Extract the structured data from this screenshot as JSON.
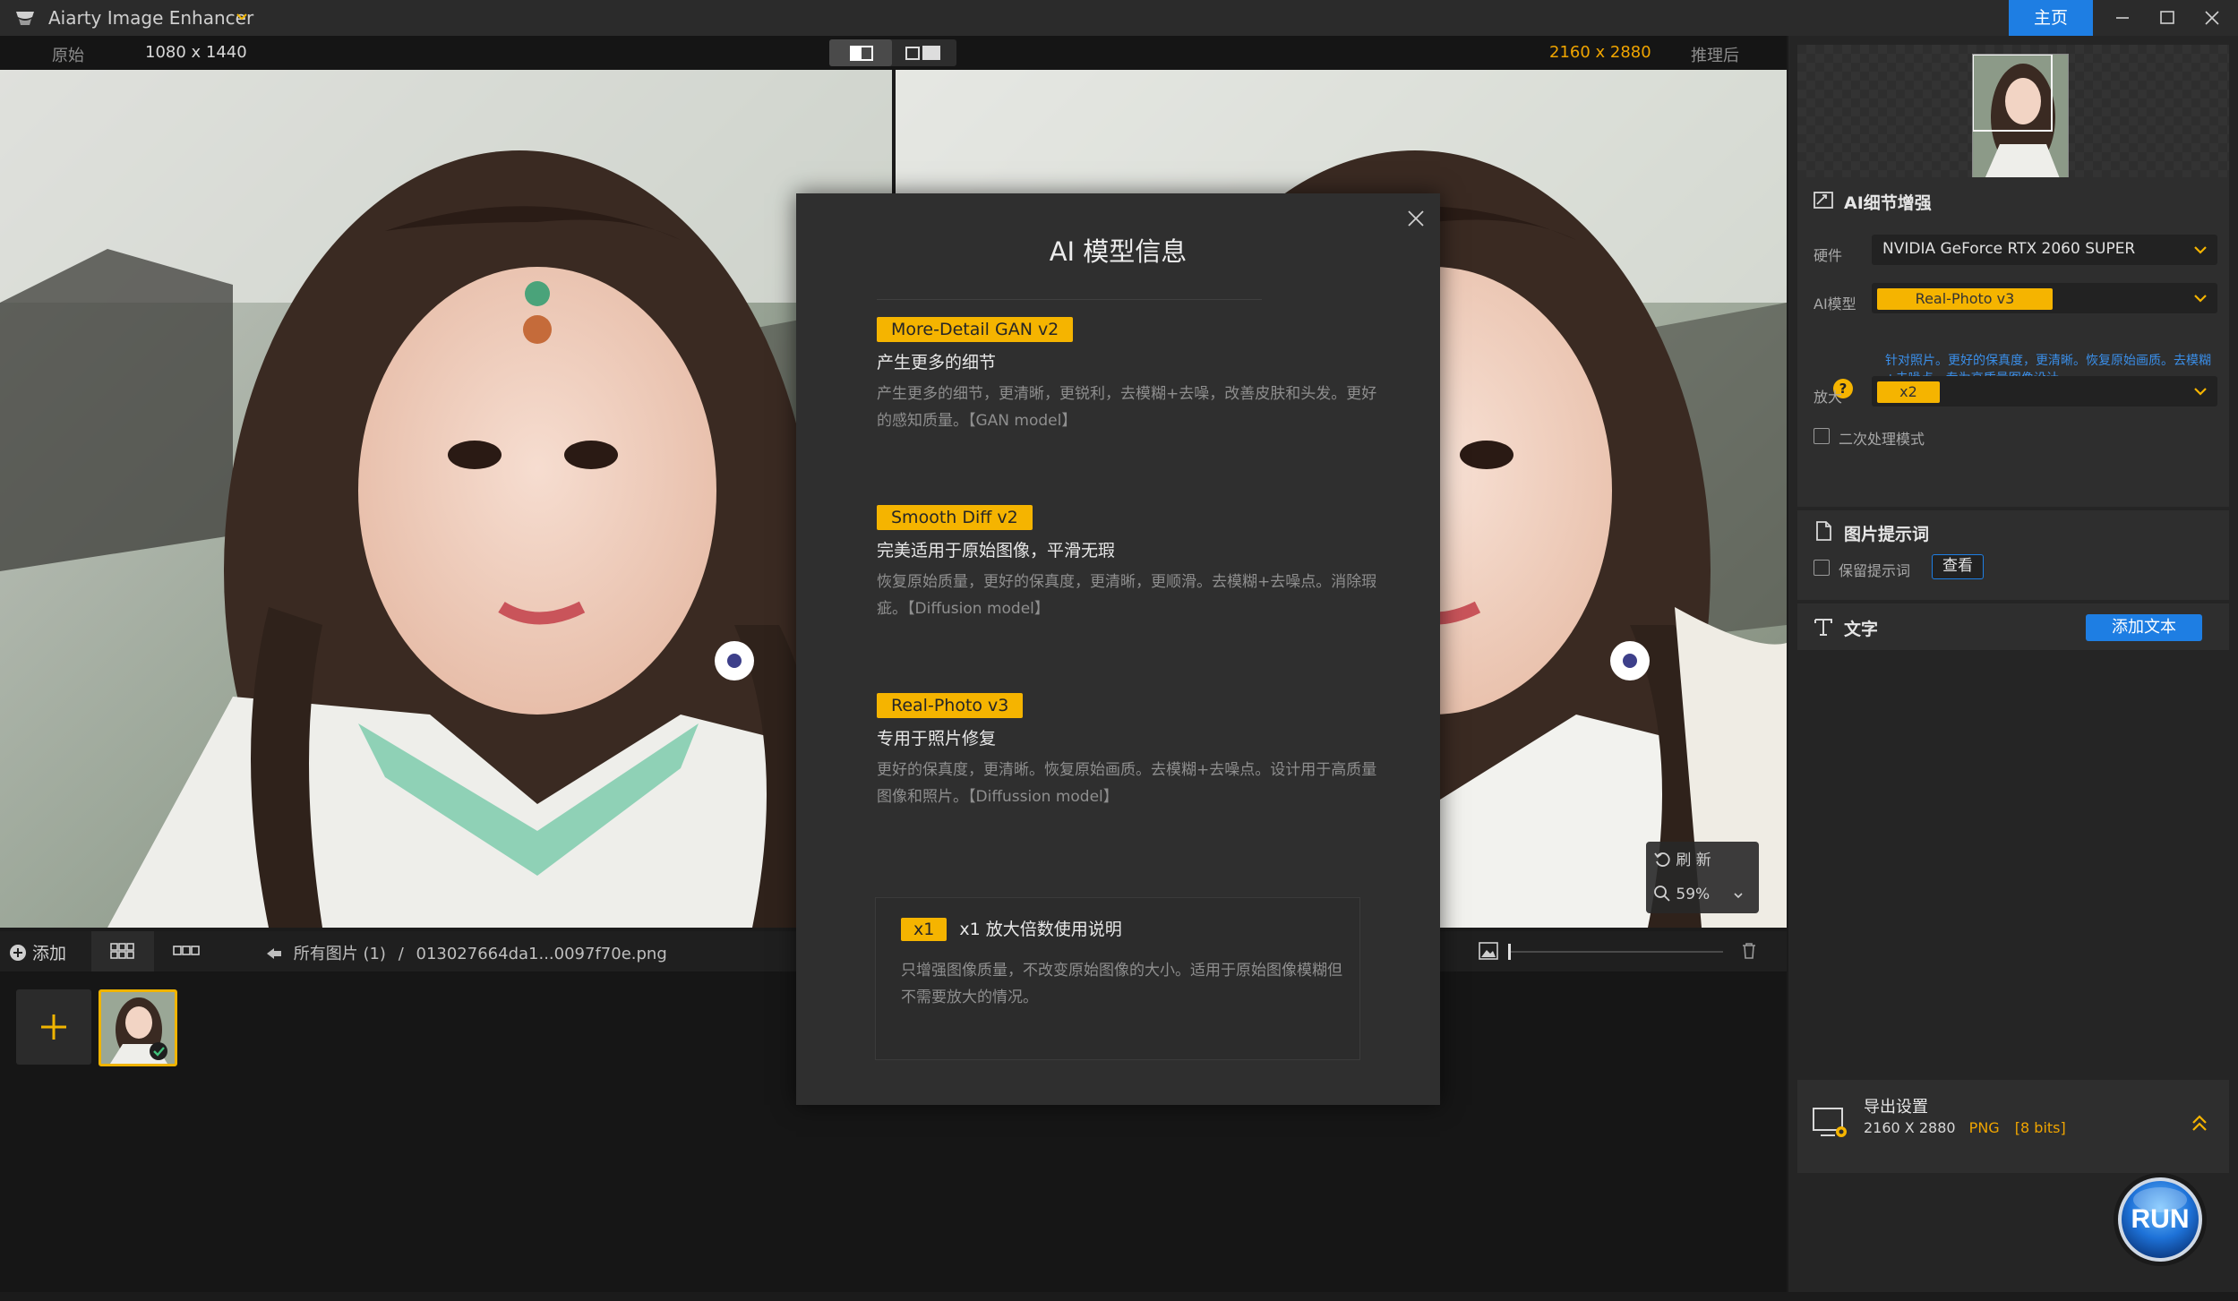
{
  "titlebar": {
    "app_title": "Aiarty Image Enhancer",
    "home_label": "主页"
  },
  "compare": {
    "original_label": "原始",
    "original_size": "1080 x 1440",
    "output_size": "2160 x 2880",
    "after_label": "推理后"
  },
  "zoom_widget": {
    "refresh_label": "刷 新",
    "zoom_value": "59%"
  },
  "filmstrip": {
    "add_label": "添加",
    "breadcrumb_root": "所有图片 (1)",
    "breadcrumb_sep": "/",
    "file_name": "013027664da1...0097f70e.png"
  },
  "right_panel": {
    "ai_section_title": "AI细节增强",
    "hardware_label": "硬件",
    "hardware_value": "NVIDIA GeForce RTX 2060 SUPER",
    "model_label": "AI模型",
    "model_value": "Real-Photo v3",
    "model_description": "针对照片。更好的保真度，更清晰。恢复原始画质。去模糊+去噪点。专为高质量图像设计。",
    "scale_label": "放大",
    "scale_value": "x2",
    "secondary_mode_label": "二次处理模式",
    "prompt_section_title": "图片提示词",
    "keep_prompt_label": "保留提示词",
    "view_button": "查看",
    "text_section_title": "文字",
    "add_text_button": "添加文本",
    "export": {
      "title": "导出设置",
      "size": "2160 X 2880",
      "format": "PNG",
      "bits": "[8 bits]"
    },
    "run_label": "RUN"
  },
  "modal": {
    "title": "AI 模型信息",
    "models": [
      {
        "name": "More-Detail GAN v2",
        "heading": "产生更多的细节",
        "desc": "产生更多的细节，更清晰，更锐利，去模糊+去噪，改善皮肤和头发。更好的感知质量。【GAN model】"
      },
      {
        "name": "Smooth Diff v2",
        "heading": "完美适用于原始图像，平滑无瑕",
        "desc": "恢复原始质量，更好的保真度，更清晰，更顺滑。去模糊+去噪点。消除瑕疵。【Diffusion model】"
      },
      {
        "name": "Real-Photo v3",
        "heading": "专用于照片修复",
        "desc": "更好的保真度，更清晰。恢复原始画质。去模糊+去噪点。设计用于高质量图像和照片。【Diffussion model】"
      }
    ],
    "x1": {
      "chip": "x1",
      "heading": "x1 放大倍数使用说明",
      "desc": "只增强图像质量，不改变原始图像的大小。适用于原始图像模糊但不需要放大的情况。"
    }
  },
  "colors": {
    "accent_blue": "#1e7ee3",
    "accent_yellow": "#f5b400",
    "output_size_orange": "#f0a500",
    "link_blue": "#3a8ee8"
  }
}
